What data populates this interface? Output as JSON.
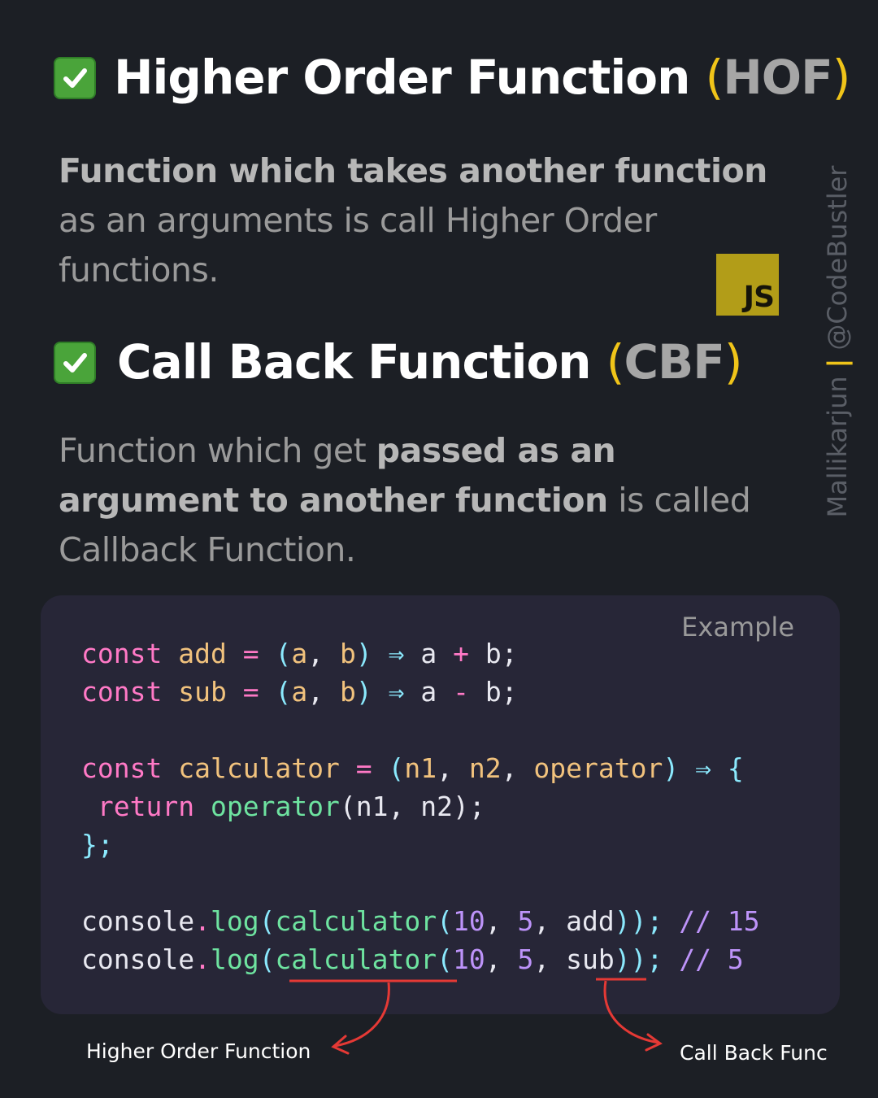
{
  "hof": {
    "title": "Higher Order Function",
    "paren_open": "(",
    "abbr": "HOF",
    "paren_close": ")",
    "desc_bold": "Function which takes another function",
    "desc_line2": "as an arguments is call Higher Order",
    "desc_line3": "functions."
  },
  "cbf": {
    "title": "Call Back Function",
    "paren_open": "(",
    "abbr": "CBF",
    "paren_close": ")",
    "desc_line1_plain": "Function which get ",
    "desc_line1_bold": "passed as an",
    "desc_line2_bold": "argument to another function",
    "desc_line2_plain": " is called",
    "desc_line3": "Callback Function."
  },
  "badge": {
    "label": "JS",
    "color": "#b29d18"
  },
  "watermark": {
    "author": "Mallikarjun",
    "separator": "|",
    "handle": "@CodeBustler"
  },
  "example": {
    "label": "Example",
    "line1": {
      "kw": "const",
      "name": "add",
      "eq": "=",
      "open": "(",
      "p1": "a",
      "comma": ",",
      "p2": "b",
      "close": ")",
      "arrow": "⇒",
      "body_a": "a",
      "op": "+",
      "body_b": "b;"
    },
    "line2": {
      "kw": "const",
      "name": "sub",
      "eq": "=",
      "open": "(",
      "p1": "a",
      "comma": ",",
      "p2": "b",
      "close": ")",
      "arrow": "⇒",
      "body_a": "a",
      "op": "-",
      "body_b": "b;"
    },
    "line3": {
      "kw": "const",
      "name": "calculator",
      "eq": "=",
      "open": "(",
      "p1": "n1",
      "c1": ",",
      "p2": "n2",
      "c2": ",",
      "p3": "operator",
      "close": ")",
      "arrow": "⇒",
      "brace": "{"
    },
    "line4": {
      "kw": "return",
      "fn": "operator",
      "args": "(n1, n2);"
    },
    "line5": {
      "text": "};"
    },
    "line6": {
      "obj": "console",
      "dot": ".",
      "method": "log",
      "open1": "(",
      "fn": "calculator",
      "open2": "(",
      "n1": "10",
      "c1": ",",
      "n2": "5",
      "c2": ",",
      "arg": "add",
      "closing": "));",
      "comment": "//",
      "result": "15"
    },
    "line7": {
      "obj": "console",
      "dot": ".",
      "method": "log",
      "open1": "(",
      "fn": "calculator",
      "open2": "(",
      "n1": "10",
      "c1": ",",
      "n2": "5",
      "c2": ",",
      "arg": "sub",
      "closing": "));",
      "comment": "//",
      "result": "5"
    }
  },
  "annotations": {
    "hof_label": "Higher Order Function",
    "cbf_label": "Call Back Func",
    "marker_color": "#e53935"
  },
  "colors": {
    "background": "#1c1f25",
    "code_background": "#272637",
    "accent_yellow": "#f0c419",
    "check_green": "#4aa43a"
  }
}
